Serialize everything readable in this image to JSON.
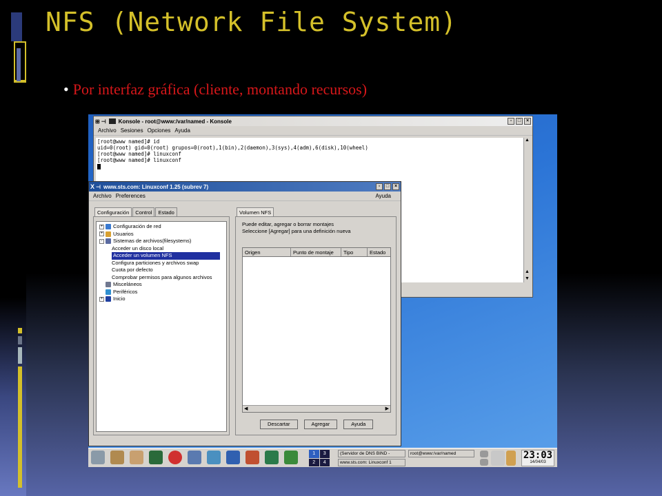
{
  "slide": {
    "title": "NFS (Network File System)",
    "bullet": "Por interfaz gráfica (cliente, montando recursos)",
    "accent_title": "#d4c02a",
    "accent_bullet": "#d8171a"
  },
  "konsole": {
    "title": "Konsole - root@www:/var/named - Konsole",
    "menu": [
      "Archivo",
      "Sesiones",
      "Opciones",
      "Ayuda"
    ],
    "lines": [
      "[root@www named]# id",
      "uid=0(root) gid=0(root) grupos=0(root),1(bin),2(daemon),3(sys),4(adm),6(disk),10(wheel)",
      "[root@www named]# linuxconf",
      "[root@www named]# linuxconf"
    ]
  },
  "linuxconf": {
    "title": "www.sts.com: Linuxconf 1.25 (subrev 7)",
    "menu": [
      "Archivo",
      "Preferences"
    ],
    "menu_right": "Ayuda",
    "left_tabs": [
      "Configuración",
      "Control",
      "Estado"
    ],
    "tree": [
      {
        "label": "Configuración de red",
        "level": 0,
        "exp": "+"
      },
      {
        "label": "Usuarios",
        "level": 0,
        "exp": "+"
      },
      {
        "label": "Sistemas de archivos(filesystems)",
        "level": 0,
        "exp": "-"
      },
      {
        "label": "Acceder un disco local",
        "level": 1
      },
      {
        "label": "Acceder un volumen NFS",
        "level": 1,
        "selected": true
      },
      {
        "label": "Configura particiones y archivos swap",
        "level": 1
      },
      {
        "label": "Cuota por defecto",
        "level": 1
      },
      {
        "label": "Comprobar permisos para algunos archivos",
        "level": 1
      },
      {
        "label": "Misceláneos",
        "level": 0
      },
      {
        "label": "Periféricos",
        "level": 0
      },
      {
        "label": "Inicio",
        "level": 0,
        "exp": "+"
      }
    ],
    "right_tab": "Volumen NFS",
    "description": [
      "Puede editar, agregar o borrar montajes",
      "Seleccione [Agregar] para una definición nueva"
    ],
    "columns": [
      "Origen",
      "Punto de montaje",
      "Tipo",
      "Estado"
    ],
    "buttons": {
      "discard": "Descartar",
      "add": "Agregar",
      "help": "Ayuda"
    }
  },
  "taskbar": {
    "pager": [
      "1",
      "3",
      "2",
      "4"
    ],
    "tasks": [
      "(Servidor de DNS BIND -",
      "root@www:/var/named",
      "www.sts.com: Linuxconf 1"
    ],
    "time": "23:03",
    "date": "14/04/03"
  }
}
